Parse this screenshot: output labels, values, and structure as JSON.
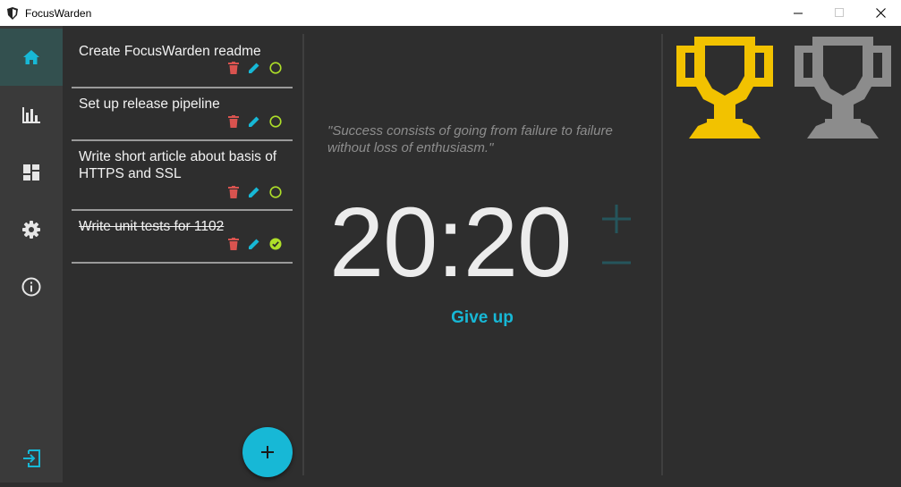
{
  "window": {
    "title": "FocusWarden",
    "minimize_icon": "minimize-icon",
    "maximize_icon": "maximize-icon",
    "close_icon": "close-icon"
  },
  "sidebar": {
    "items": [
      {
        "name": "home",
        "icon": "home-icon",
        "active": true
      },
      {
        "name": "statistics",
        "icon": "bar-chart-icon",
        "active": false
      },
      {
        "name": "dashboard",
        "icon": "dashboard-icon",
        "active": false
      },
      {
        "name": "settings",
        "icon": "gear-icon",
        "active": false
      },
      {
        "name": "about",
        "icon": "info-icon",
        "active": false
      }
    ],
    "logout_icon": "exit-icon"
  },
  "tasks": [
    {
      "title": "Create FocusWarden readme",
      "completed": false
    },
    {
      "title": "Set up release pipeline",
      "completed": false
    },
    {
      "title": "Write short article about basis of HTTPS and SSL",
      "completed": false
    },
    {
      "title": "Write unit tests for 1102",
      "completed": true
    }
  ],
  "add_button_icon": "plus-icon",
  "quote": "\"Success consists of going from failure to failure without loss of enthusiasm.\"",
  "timer": {
    "value": "20:20",
    "increase_icon": "plus-icon",
    "decrease_icon": "minus-icon"
  },
  "give_up_label": "Give up",
  "trophies": [
    {
      "state": "earned",
      "color": "#f2c200"
    },
    {
      "state": "locked",
      "color": "#8c8c8c"
    }
  ],
  "colors": {
    "accent": "#17b8d6",
    "delete": "#d9534f",
    "edit": "#17b8d6",
    "complete": "#aedf29",
    "background": "#2e2e2e",
    "sidebar": "#3a3a3a"
  }
}
